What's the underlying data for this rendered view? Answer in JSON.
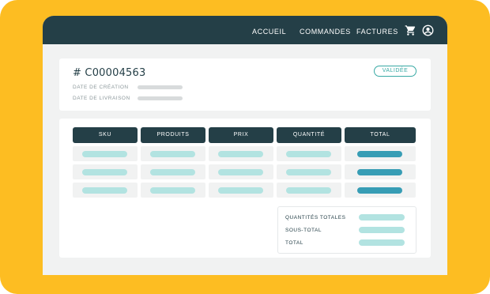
{
  "nav": {
    "links": [
      "ACCUEIL",
      "COMMANDES",
      "FACTURES"
    ],
    "cart_icon": "cart-icon",
    "account_icon": "user-circle-icon"
  },
  "order": {
    "number": "# C00004563",
    "status": "VALIDÉE",
    "creation_label": "DATE DE CRÉATION",
    "delivery_label": "DATE DE LIVRAISON"
  },
  "table": {
    "headers": [
      "SKU",
      "PRODUITS",
      "PRIX",
      "QUANTITÉ",
      "TOTAL"
    ],
    "row_count": 3
  },
  "summary": {
    "labels": [
      "QUANTITÉS TOTALES",
      "SOUS-TOTAL",
      "TOTAL"
    ]
  },
  "colors": {
    "frame": "#fdbd22",
    "navbar": "#243f47",
    "accent_teal": "#38a9a4",
    "placeholder_light": "#b2e3e1",
    "placeholder_dark": "#379db5"
  }
}
